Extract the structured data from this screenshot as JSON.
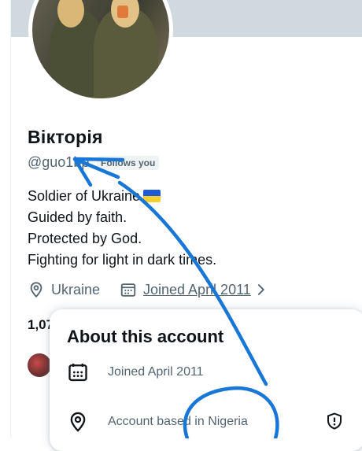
{
  "profile": {
    "display_name": "Вікторія",
    "handle": "@guo1bp",
    "follows_badge": "Follows you",
    "bio": [
      "Soldier of Ukraine",
      "Guided by faith.",
      "Protected by God.",
      "Fighting for light in dark times."
    ],
    "location": "Ukraine",
    "joined": "Joined April 2011",
    "stats_partial": "1,07"
  },
  "popup": {
    "title": "About this account",
    "joined": "Joined April 2011",
    "based_in": "Account based in Nigeria"
  },
  "icons": {
    "location": "location-pin-icon",
    "calendar": "calendar-icon",
    "chevron": "chevron-right-icon",
    "shield": "shield-alert-icon"
  },
  "colors": {
    "text_primary": "#0f1419",
    "text_secondary": "#536471",
    "banner": "#cfd9de",
    "annotation_blue": "#1877d6",
    "flag_blue": "#1f5bd6",
    "flag_yellow": "#f7cf2c"
  }
}
